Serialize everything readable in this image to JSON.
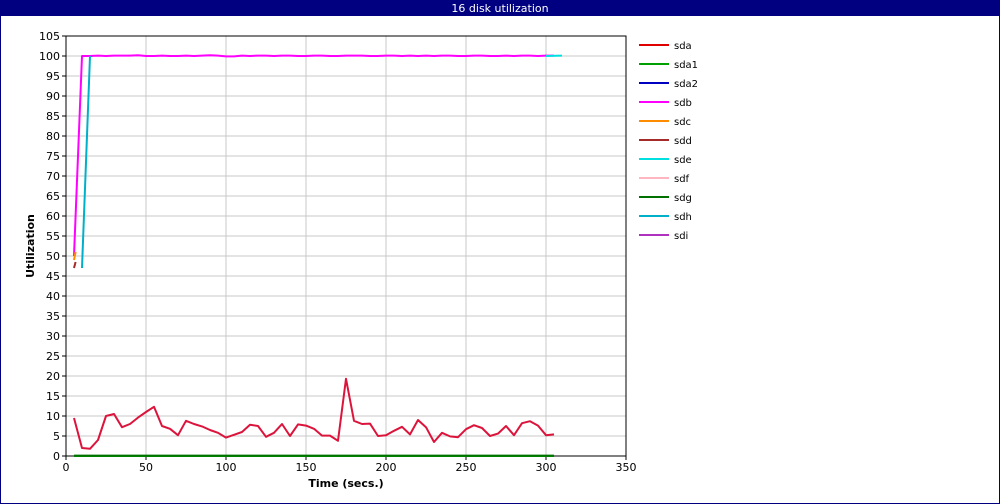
{
  "window": {
    "title": "16 disk utilization"
  },
  "chart_data": {
    "type": "line",
    "title": "16 disk utilization",
    "xlabel": "Time (secs.)",
    "ylabel": "Utilization",
    "xlim": [
      0,
      350
    ],
    "ylim": [
      0,
      105
    ],
    "xticks": [
      0,
      50,
      100,
      150,
      200,
      250,
      300,
      350
    ],
    "yticks": [
      0,
      5,
      10,
      15,
      20,
      25,
      30,
      35,
      40,
      45,
      50,
      55,
      60,
      65,
      70,
      75,
      80,
      85,
      90,
      95,
      100,
      105
    ],
    "grid": true,
    "legend_position": "right",
    "series": [
      {
        "name": "sda",
        "color": "#e00000",
        "x": [],
        "y": []
      },
      {
        "name": "sda1",
        "color": "#00a000",
        "x": [
          5,
          305
        ],
        "y": [
          0,
          0
        ]
      },
      {
        "name": "sda2",
        "color": "#0000c0",
        "x": [],
        "y": []
      },
      {
        "name": "sdb",
        "color": "#ff00ff",
        "x": [
          5,
          10,
          15,
          20,
          25,
          30,
          35,
          40,
          45,
          50,
          55,
          60,
          65,
          70,
          75,
          80,
          85,
          90,
          95,
          100,
          105,
          110,
          115,
          120,
          125,
          130,
          135,
          140,
          145,
          150,
          155,
          160,
          165,
          170,
          175,
          180,
          185,
          190,
          195,
          200,
          205,
          210,
          215,
          220,
          225,
          230,
          235,
          240,
          245,
          250,
          255,
          260,
          265,
          270,
          275,
          280,
          285,
          290,
          295,
          300,
          305
        ],
        "y": [
          50,
          100,
          100,
          100.1,
          100,
          100.1,
          100.1,
          100.1,
          100.2,
          100,
          100,
          100.1,
          100,
          100,
          100.1,
          100,
          100.1,
          100.2,
          100.1,
          99.9,
          99.9,
          100.1,
          100,
          100.1,
          100.1,
          100,
          100.1,
          100.1,
          100,
          100,
          100.1,
          100.1,
          100,
          100,
          100.1,
          100.1,
          100.1,
          100,
          100,
          100.1,
          100.1,
          100,
          100.1,
          100,
          100.1,
          100,
          100.1,
          100.1,
          100,
          100,
          100.1,
          100.1,
          100,
          100,
          100.1,
          100,
          100.1,
          100.1,
          100,
          100.1,
          100.1
        ]
      },
      {
        "name": "sdc",
        "color": "#ff8c00",
        "x": [
          5,
          6
        ],
        "y": [
          49,
          51
        ]
      },
      {
        "name": "sdd",
        "color": "#a52a2a",
        "x": [
          5,
          6
        ],
        "y": [
          47,
          48.5
        ]
      },
      {
        "name": "sde",
        "color": "#00e0e0",
        "x": [
          300,
          310
        ],
        "y": [
          100,
          100.1
        ]
      },
      {
        "name": "sdf",
        "color": "#ffb6c1",
        "x": [],
        "y": []
      },
      {
        "name": "sdg",
        "color": "#007000",
        "x": [
          5,
          305
        ],
        "y": [
          0.1,
          0.1
        ]
      },
      {
        "name": "sdh",
        "color": "#00b0c8",
        "x": [
          10,
          15
        ],
        "y": [
          47,
          100
        ]
      },
      {
        "name": "sdi",
        "color": "#b030c0",
        "x": [],
        "y": []
      },
      {
        "name": "",
        "color": "#dc143c",
        "x": [
          5,
          10,
          15,
          20,
          25,
          30,
          35,
          40,
          45,
          50,
          55,
          60,
          65,
          70,
          75,
          80,
          85,
          90,
          95,
          100,
          105,
          110,
          115,
          120,
          125,
          130,
          135,
          140,
          145,
          150,
          155,
          160,
          165,
          170,
          175,
          180,
          185,
          190,
          195,
          200,
          205,
          210,
          215,
          220,
          225,
          230,
          235,
          240,
          245,
          250,
          255,
          260,
          265,
          270,
          275,
          280,
          285,
          290,
          295,
          300,
          305
        ],
        "y": [
          9.5,
          2,
          1.8,
          4,
          10,
          10.5,
          7.2,
          8,
          9.6,
          11,
          12.3,
          7.5,
          6.8,
          5.2,
          8.8,
          8,
          7.4,
          6.5,
          5.8,
          4.6,
          5.3,
          6,
          7.8,
          7.5,
          4.8,
          5.8,
          8,
          5,
          7.9,
          7.6,
          6.8,
          5.1,
          5.1,
          3.8,
          19.3,
          8.8,
          8,
          8.1,
          5,
          5.2,
          6.3,
          7.3,
          5.4,
          9,
          7.2,
          3.5,
          5.8,
          4.9,
          4.7,
          6.7,
          7.7,
          7,
          5,
          5.6,
          7.5,
          5.2,
          8.2,
          8.7,
          7.6,
          5.2,
          5.4
        ]
      }
    ]
  }
}
